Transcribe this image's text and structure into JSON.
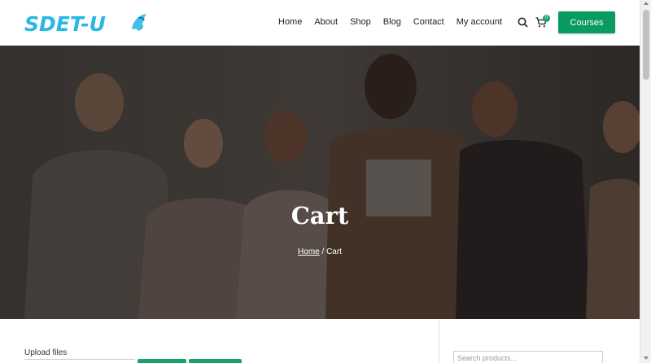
{
  "header": {
    "logo_text": "SDET-U",
    "nav": [
      "Home",
      "About",
      "Shop",
      "Blog",
      "Contact",
      "My account"
    ],
    "cart_count": "0",
    "courses_label": "Courses",
    "icons": [
      "search-icon",
      "cart-icon"
    ]
  },
  "hero": {
    "title": "Cart",
    "breadcrumb_home": "Home",
    "breadcrumb_sep": " / ",
    "breadcrumb_current": "Cart"
  },
  "content": {
    "upload_label": "Upload files",
    "search_placeholder": "Search products..."
  },
  "colors": {
    "accent": "#0a9b63",
    "logo": "#29b7e6"
  }
}
